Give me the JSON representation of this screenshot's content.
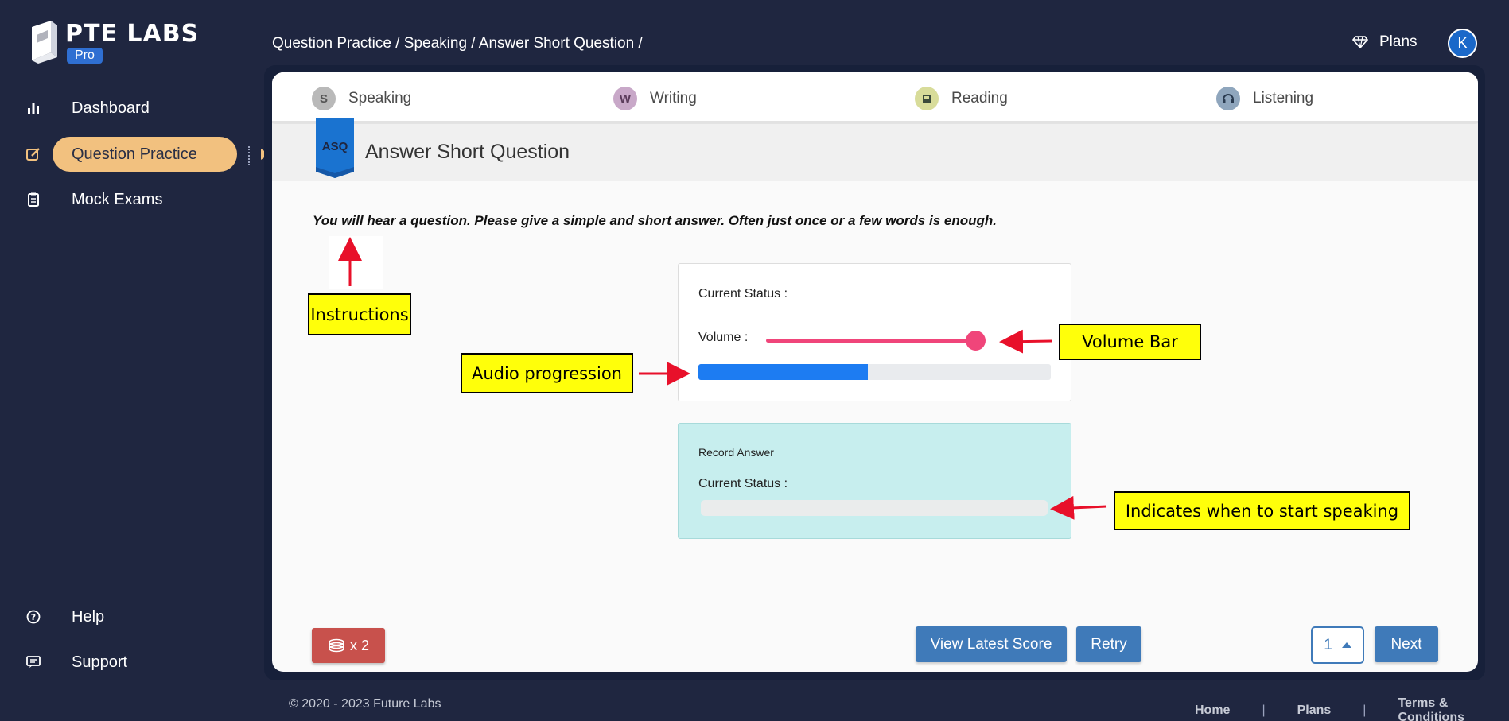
{
  "brand": {
    "name": "PTE LABS",
    "badge": "Pro"
  },
  "sidebar": {
    "items": [
      {
        "label": "Dashboard",
        "icon": "bar-chart-icon"
      },
      {
        "label": "Question Practice",
        "icon": "edit-icon",
        "active": true
      },
      {
        "label": "Mock Exams",
        "icon": "clipboard-icon"
      }
    ],
    "bottom_items": [
      {
        "label": "Help",
        "icon": "question-circle-icon"
      },
      {
        "label": "Support",
        "icon": "support-ticket-icon"
      }
    ]
  },
  "header": {
    "breadcrumb": "Question Practice / Speaking / Answer Short Question /",
    "plans_label": "Plans",
    "plans_icon": "diamond-icon",
    "avatar_initial": "K"
  },
  "tabs": [
    {
      "label": "Speaking",
      "icon": "speaking-icon",
      "color": "#b9b9b9"
    },
    {
      "label": "Writing",
      "icon": "writing-icon",
      "color": "#c8a8c8"
    },
    {
      "label": "Reading",
      "icon": "reading-icon",
      "color": "#d8dc9a"
    },
    {
      "label": "Listening",
      "icon": "headphones-icon",
      "color": "#8fa6bd"
    }
  ],
  "question": {
    "badge": "ASQ",
    "title": "Answer Short Question",
    "instructions": "You will hear a question. Please give a simple and short answer. Often just once or a few words is enough."
  },
  "audio_panel": {
    "status_label": "Current Status :",
    "volume_label": "Volume :",
    "volume_level": 1.0,
    "progress": 0.48
  },
  "record_panel": {
    "title": "Record Answer",
    "status_label": "Current Status :",
    "progress": 0
  },
  "actions": {
    "coin_label": "x 2",
    "view_score": "View Latest Score",
    "retry": "Retry",
    "page_value": "1",
    "next": "Next"
  },
  "annotations": {
    "instructions": "Instructions",
    "audio": "Audio progression",
    "volume": "Volume Bar",
    "speaking": "Indicates when to start speaking"
  },
  "footer": {
    "copyright": "© 2020 - 2023 Future Labs",
    "links": [
      "Home",
      "Plans",
      "Terms & Conditions"
    ],
    "separator": "|"
  },
  "colors": {
    "background": "#1f2640",
    "active_nav": "#f2c17f",
    "primary_button": "#3f7ab9",
    "volume": "#f0457a",
    "progress": "#1d7cf2",
    "record_panel": "#c7eeee",
    "annotation": "#ffff0a",
    "annotation_arrow": "#e8102a"
  }
}
